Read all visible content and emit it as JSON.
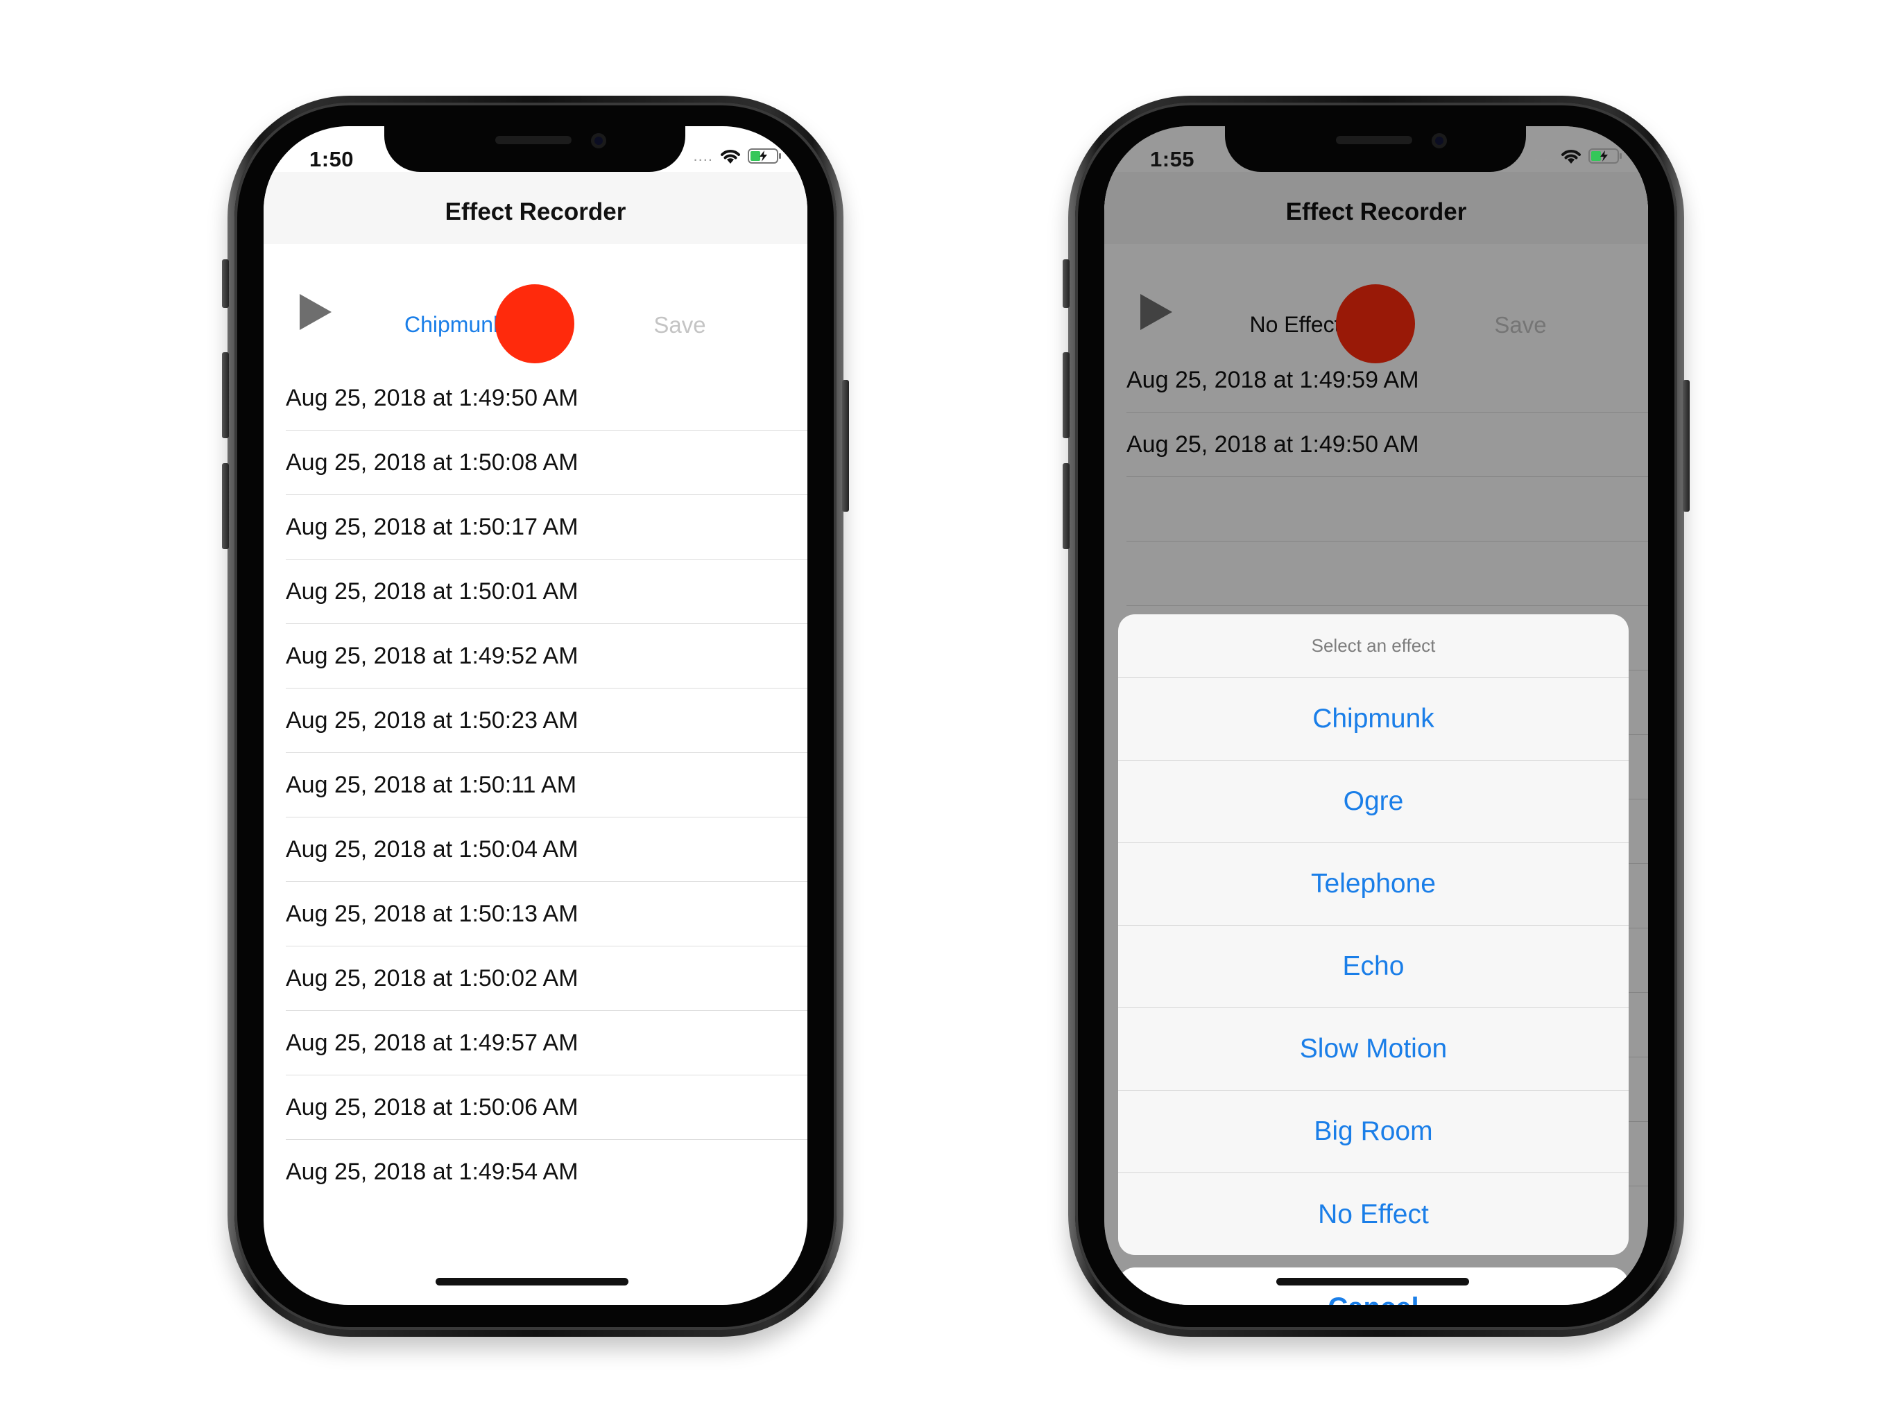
{
  "left_phone": {
    "status_time": "1:50",
    "nav_title": "Effect Recorder",
    "toolbar": {
      "effect_label": "Chipmunk",
      "save_label": "Save"
    },
    "recordings": [
      "Aug 25, 2018 at 1:49:50 AM",
      "Aug 25, 2018 at 1:50:08 AM",
      "Aug 25, 2018 at 1:50:17 AM",
      "Aug 25, 2018 at 1:50:01 AM",
      "Aug 25, 2018 at 1:49:52 AM",
      "Aug 25, 2018 at 1:50:23 AM",
      "Aug 25, 2018 at 1:50:11 AM",
      "Aug 25, 2018 at 1:50:04 AM",
      "Aug 25, 2018 at 1:50:13 AM",
      "Aug 25, 2018 at 1:50:02 AM",
      "Aug 25, 2018 at 1:49:57 AM",
      "Aug 25, 2018 at 1:50:06 AM",
      "Aug 25, 2018 at 1:49:54 AM"
    ]
  },
  "right_phone": {
    "status_time": "1:55",
    "nav_title": "Effect Recorder",
    "toolbar": {
      "effect_label": "No Effect",
      "save_label": "Save"
    },
    "recordings": [
      "Aug 25, 2018 at 1:49:59 AM",
      "Aug 25, 2018 at 1:49:50 AM"
    ],
    "action_sheet": {
      "title": "Select an effect",
      "options": [
        "Chipmunk",
        "Ogre",
        "Telephone",
        "Echo",
        "Slow Motion",
        "Big Room",
        "No Effect"
      ],
      "cancel_label": "Cancel"
    }
  },
  "colors": {
    "accent": "#1a7ee8",
    "record": "#ff2a0c",
    "save_disabled": "#c4c4c4",
    "nav_bar": "#f6f6f6"
  },
  "icons": [
    "play-icon",
    "record-icon",
    "wifi-icon",
    "battery-charging-icon",
    "signal-dots-icon"
  ]
}
